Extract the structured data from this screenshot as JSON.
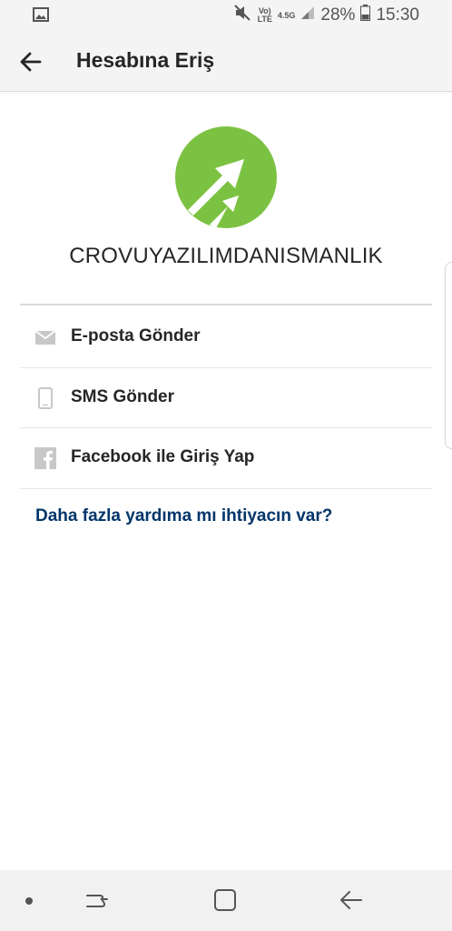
{
  "status_bar": {
    "net_line1": "Vo)\nLTE",
    "net_line2": "4.5G",
    "battery": "28%",
    "time": "15:30"
  },
  "app_bar": {
    "title": "Hesabına Eriş"
  },
  "account": {
    "name": "CROVUYAZILIMDANISMANLIK",
    "logo_color": "#7cc242"
  },
  "options": [
    {
      "label": "E-posta Gönder",
      "icon": "mail-icon"
    },
    {
      "label": "SMS Gönder",
      "icon": "phone-icon"
    },
    {
      "label": "Facebook ile Giriş Yap",
      "icon": "facebook-icon"
    }
  ],
  "help_link": {
    "label": "Daha fazla yardıma mı ihtiyacın var?",
    "color": "#003569"
  }
}
